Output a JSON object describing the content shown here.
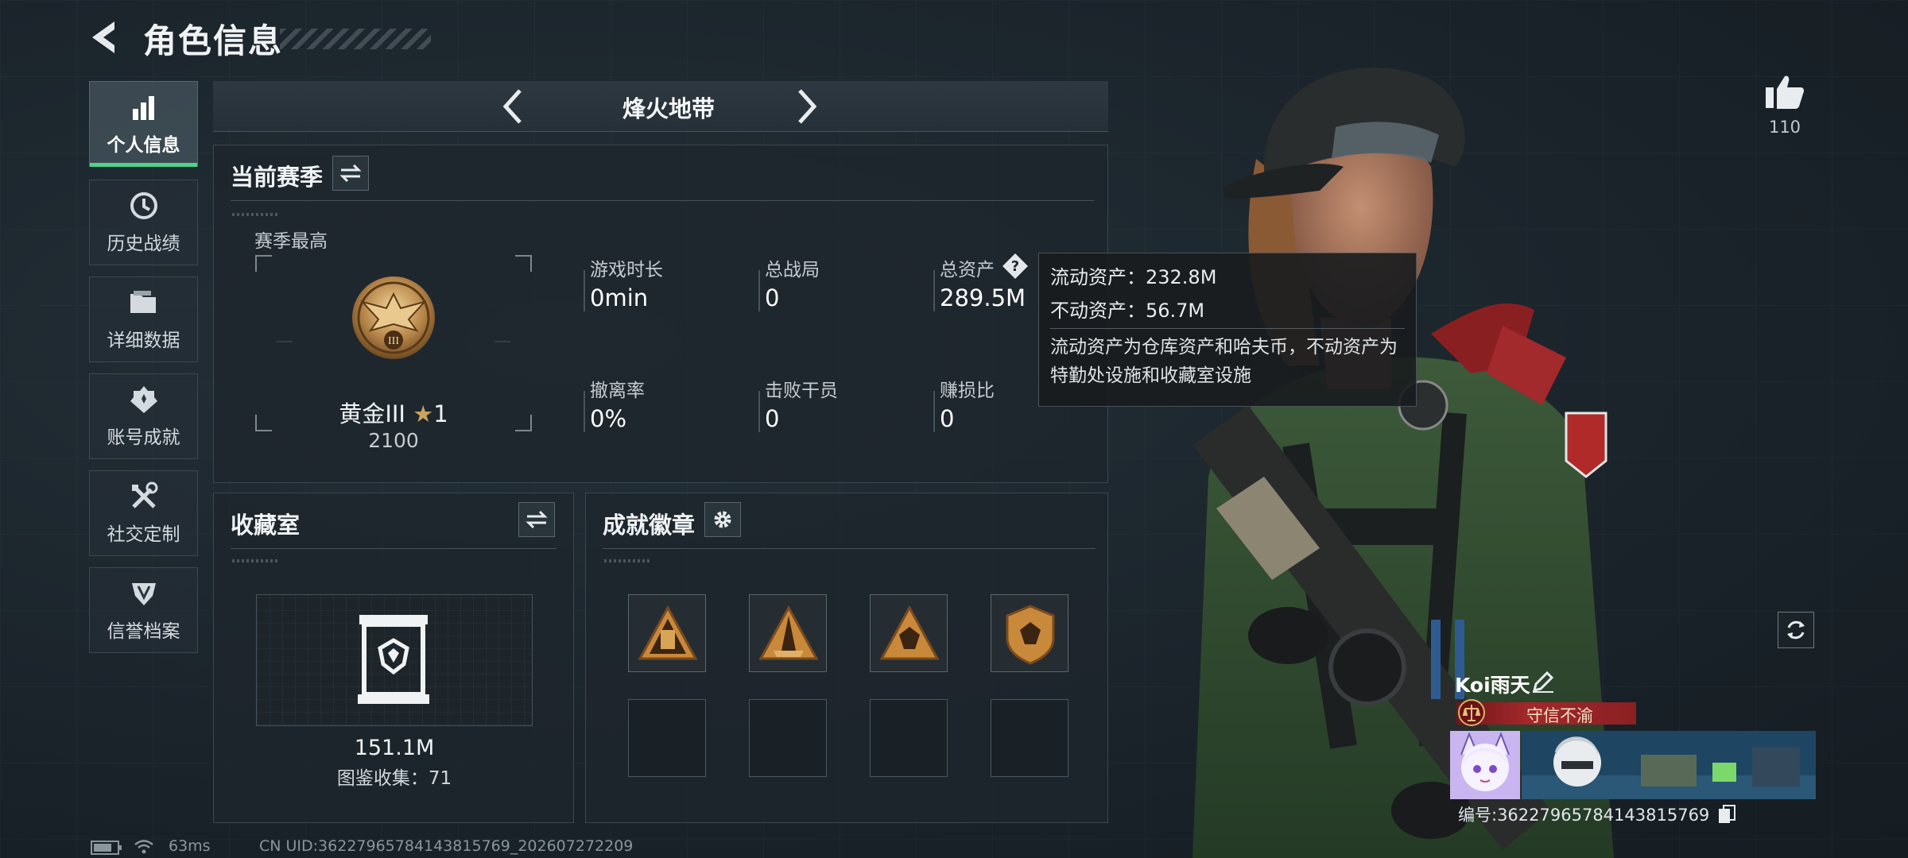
{
  "header": {
    "title": "角色信息"
  },
  "nav": {
    "items": [
      {
        "label": "个人信息",
        "icon": "bar-chart-icon",
        "active": true
      },
      {
        "label": "历史战绩",
        "icon": "history-clock-icon",
        "active": false
      },
      {
        "label": "详细数据",
        "icon": "folder-icon",
        "active": false
      },
      {
        "label": "账号成就",
        "icon": "achievement-icon",
        "active": false
      },
      {
        "label": "社交定制",
        "icon": "tools-icon",
        "active": false
      },
      {
        "label": "信誉档案",
        "icon": "reputation-shield-icon",
        "active": false
      }
    ]
  },
  "mode": {
    "title": "烽火地带"
  },
  "season": {
    "title": "当前赛季",
    "best_label": "赛季最高",
    "rank_name": "黄金III",
    "rank_stars": "1",
    "rank_score": "2100",
    "stats": [
      {
        "label": "游戏时长",
        "value": "0min"
      },
      {
        "label": "总战局",
        "value": "0"
      },
      {
        "label": "总资产",
        "value": "289.5M"
      },
      {
        "label": "撤离率",
        "value": "0%"
      },
      {
        "label": "击败干员",
        "value": "0"
      },
      {
        "label": "赚损比",
        "value": "0"
      }
    ]
  },
  "tooltip": {
    "liquid": "流动资产：232.8M",
    "fixed": "不动资产：56.7M",
    "note": "流动资产为仓库资产和哈夫币，不动资产为特勤处设施和收藏室设施"
  },
  "collection": {
    "title": "收藏室",
    "value": "151.1M",
    "catalog": "图鉴收集：71"
  },
  "badges": {
    "title": "成就徽章"
  },
  "player": {
    "likes": "110",
    "name": "Koi雨天",
    "title_badge": "守信不渝",
    "id": "编号:3622796578414381​5769"
  },
  "status": {
    "ping": "63ms",
    "uid": "CN UID:3622796578414381​5769_202607272209"
  },
  "colors": {
    "accent_green": "#4fd38a",
    "title_red": "#a3282b",
    "tooltip_bg": "#181c1e"
  }
}
